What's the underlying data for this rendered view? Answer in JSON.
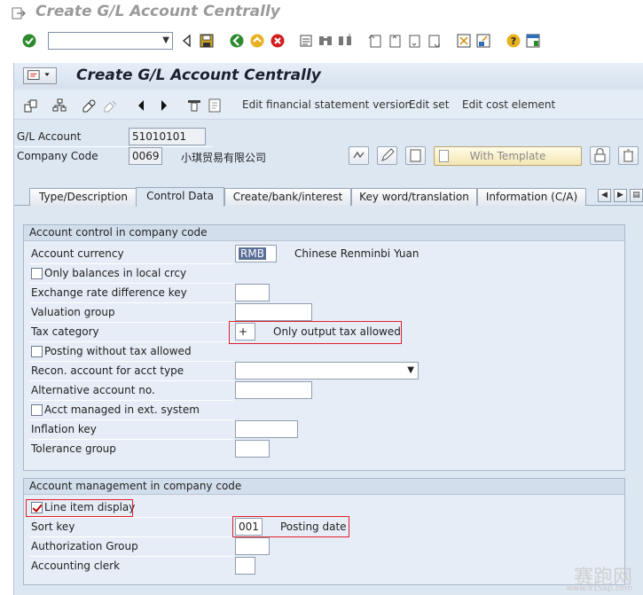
{
  "window": {
    "title": "Create G/L Account Centrally"
  },
  "screen": {
    "title": "Create G/L Account Centrally"
  },
  "toolbar": {
    "command_field": ""
  },
  "app_toolbar": {
    "items": [
      "Edit financial statement version",
      "Edit set",
      "Edit cost element"
    ]
  },
  "header": {
    "gl_account_label": "G/L Account",
    "gl_account_value": "51010101",
    "company_code_label": "Company Code",
    "company_code_value": "0069",
    "company_name": "小琪贸易有限公司",
    "with_template_label": "With Template"
  },
  "tabs": [
    {
      "label": "Type/Description",
      "active": false
    },
    {
      "label": "Control Data",
      "active": true
    },
    {
      "label": "Create/bank/interest",
      "active": false
    },
    {
      "label": "Key word/translation",
      "active": false
    },
    {
      "label": "Information (C/A)",
      "active": false
    }
  ],
  "account_control": {
    "title": "Account control in company code",
    "account_currency_label": "Account currency",
    "account_currency_value": "RMB",
    "account_currency_text": "Chinese Renminbi Yuan",
    "only_balances_label": "Only balances in local crcy",
    "only_balances_checked": false,
    "exchange_rate_label": "Exchange rate difference key",
    "exchange_rate_value": "",
    "valuation_group_label": "Valuation group",
    "valuation_group_value": "",
    "tax_category_label": "Tax category",
    "tax_category_value": "+",
    "tax_category_text": "Only output tax allowed",
    "posting_without_tax_label": "Posting without tax allowed",
    "posting_without_tax_checked": false,
    "recon_account_label": "Recon. account for acct type",
    "recon_account_value": "",
    "alternative_account_label": "Alternative account no.",
    "alternative_account_value": "",
    "acct_managed_label": "Acct managed in ext. system",
    "acct_managed_checked": false,
    "inflation_key_label": "Inflation key",
    "inflation_key_value": "",
    "tolerance_group_label": "Tolerance group",
    "tolerance_group_value": ""
  },
  "account_management": {
    "title": "Account management in company code",
    "line_item_display_label": "Line item display",
    "line_item_display_checked": true,
    "sort_key_label": "Sort key",
    "sort_key_value": "001",
    "sort_key_text": "Posting date",
    "authorization_group_label": "Authorization Group",
    "authorization_group_value": "",
    "accounting_clerk_label": "Accounting clerk",
    "accounting_clerk_value": ""
  },
  "watermark": {
    "text": "赛跑网",
    "url": "www.91Sap.com"
  },
  "colors": {
    "highlight_box": "#e0202a",
    "panel_bg": "#dde7f2",
    "accent": "#5a6f98"
  }
}
